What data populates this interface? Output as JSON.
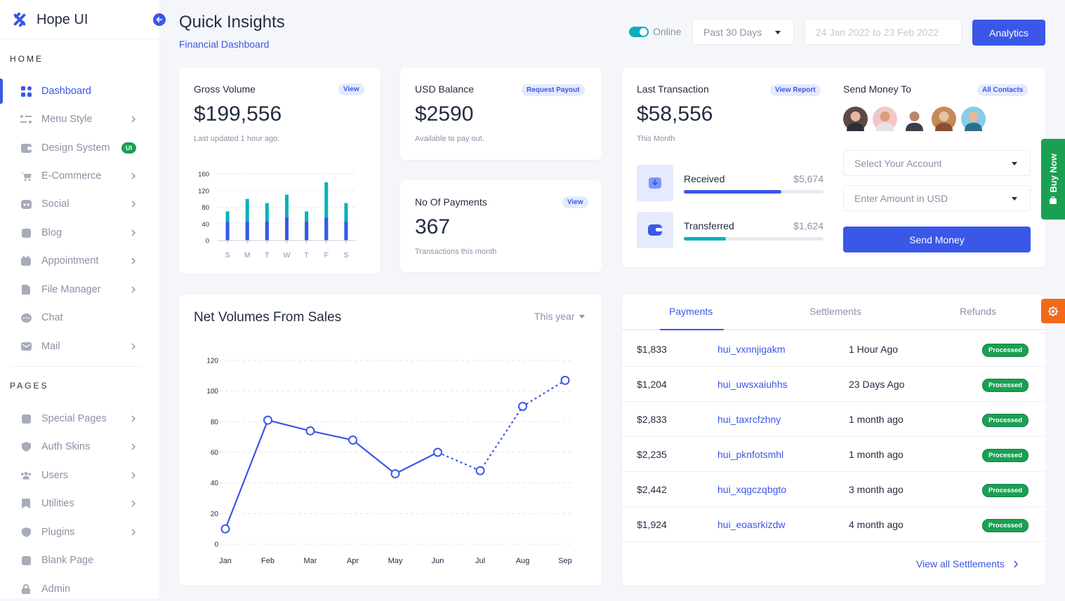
{
  "brand": {
    "name": "Hope UI"
  },
  "sidebar": {
    "home_title": "HOME",
    "pages_title": "PAGES",
    "home_items": [
      {
        "label": "Dashboard"
      },
      {
        "label": "Menu Style"
      },
      {
        "label": "Design System",
        "badge": "UI"
      },
      {
        "label": "E-Commerce"
      },
      {
        "label": "Social"
      },
      {
        "label": "Blog"
      },
      {
        "label": "Appointment"
      },
      {
        "label": "File Manager"
      },
      {
        "label": "Chat"
      },
      {
        "label": "Mail"
      }
    ],
    "pages_items": [
      {
        "label": "Special Pages"
      },
      {
        "label": "Auth Skins"
      },
      {
        "label": "Users"
      },
      {
        "label": "Utilities"
      },
      {
        "label": "Plugins"
      },
      {
        "label": "Blank Page"
      },
      {
        "label": "Admin"
      }
    ]
  },
  "header": {
    "title": "Quick Insights",
    "subtitle": "Financial Dashboard",
    "online_label": "Online",
    "period_select": "Past 30 Days",
    "date_range_placeholder": "24 Jan 2022 to 23 Feb 2022",
    "analytics_button": "Analytics"
  },
  "gross": {
    "label": "Gross Volume",
    "pill": "View",
    "value": "$199,556",
    "note": "Last updated 1 hour ago.",
    "chart_data": {
      "type": "bar",
      "categories": [
        "S",
        "M",
        "T",
        "W",
        "T",
        "F",
        "S"
      ],
      "ylim": [
        0,
        160
      ],
      "yticks": [
        "160",
        "120",
        "80",
        "40",
        "0"
      ],
      "series": [
        {
          "values": [
            70,
            100,
            90,
            110,
            70,
            140,
            90
          ],
          "color": "#08b1ba"
        },
        {
          "values": [
            45,
            45,
            45,
            55,
            45,
            55,
            45
          ],
          "color": "#3a57e8"
        }
      ]
    }
  },
  "usd": {
    "label": "USD Balance",
    "pill": "Request Payout",
    "value": "$2590",
    "note": "Available to pay out."
  },
  "payments_count": {
    "label": "No Of Payments",
    "pill": "View",
    "value": "367",
    "note": "Transactions this month"
  },
  "last_tx": {
    "label": "Last Transaction",
    "pill": "View Report",
    "value": "$58,556",
    "note": "This Month",
    "received": {
      "label": "Received",
      "amount": "$5,674",
      "progress": 0.7,
      "color": "#3a57e8"
    },
    "transferred": {
      "label": "Transferred",
      "amount": "$1,624",
      "progress": 0.3,
      "color": "#08b1ba"
    }
  },
  "send_money": {
    "label": "Send Money To",
    "pill": "All Contacts",
    "select_account": "Select Your Account",
    "amount_placeholder": "Enter Amount in USD",
    "button": "Send Money"
  },
  "net_volumes": {
    "title": "Net Volumes From Sales",
    "period": "This year",
    "chart_data": {
      "type": "line",
      "x": [
        "Jan",
        "Feb",
        "Mar",
        "Apr",
        "May",
        "Jun",
        "Jul",
        "Aug",
        "Sep"
      ],
      "y": [
        10,
        81,
        74,
        68,
        46,
        60,
        48,
        90,
        107
      ],
      "ylim": [
        0,
        120
      ],
      "yticks": [
        "0",
        "20",
        "40",
        "60",
        "80",
        "100",
        "120"
      ],
      "color": "#3a57e8"
    }
  },
  "tabs": [
    "Payments",
    "Settlements",
    "Refunds"
  ],
  "transactions": [
    {
      "amount": "$1,833",
      "id": "hui_vxnnjigakm",
      "time": "1 Hour Ago",
      "status": "Processed"
    },
    {
      "amount": "$1,204",
      "id": "hui_uwsxaiuhhs",
      "time": "23 Days Ago",
      "status": "Processed"
    },
    {
      "amount": "$2,833",
      "id": "hui_taxrcfzhny",
      "time": "1 month ago",
      "status": "Processed"
    },
    {
      "amount": "$2,235",
      "id": "hui_pknfotsmhl",
      "time": "1 month ago",
      "status": "Processed"
    },
    {
      "amount": "$2,442",
      "id": "hui_xqgczqbgto",
      "time": "3 month ago",
      "status": "Processed"
    },
    {
      "amount": "$1,924",
      "id": "hui_eoasrkizdw",
      "time": "4 month ago",
      "status": "Processed"
    }
  ],
  "view_all": "View all Settlements",
  "buy_now": "Buy Now",
  "colors": {
    "primary": "#3a57e8",
    "teal": "#08b1ba",
    "success": "#1aa053",
    "orange": "#f16a1b"
  }
}
